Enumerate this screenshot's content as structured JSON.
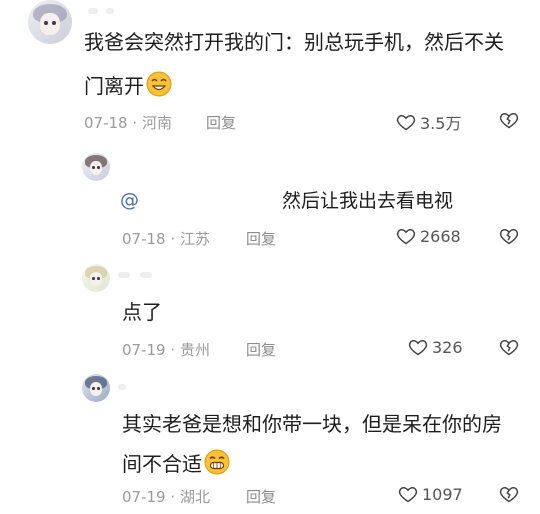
{
  "comments": [
    {
      "text_line1": "我爸会突然打开我的门：别总玩手机，然后不关",
      "text_line2": "门离开",
      "date": "07-18",
      "region": "河南",
      "reply_label": "回复",
      "likes": "3.5万",
      "emoji_icon": "squinting-smile-emoji"
    },
    {
      "mention": "@",
      "text_line1": "然后让我出去看电视",
      "date": "07-18",
      "region": "江苏",
      "reply_label": "回复",
      "likes": "2668"
    },
    {
      "text_line1": "点了",
      "date": "07-19",
      "region": "贵州",
      "reply_label": "回复",
      "likes": "326"
    },
    {
      "text_line1": "其实老爸是想和你带一块，但是呆在你的房",
      "text_line2": "间不合适",
      "date": "07-19",
      "region": "湖北",
      "reply_label": "回复",
      "likes": "1097",
      "emoji_icon": "grinning-teeth-emoji"
    }
  ],
  "meta_separator": "·",
  "icons": {
    "like": "heart-outline-icon",
    "dislike": "broken-heart-outline-icon"
  },
  "colors": {
    "text": "#1e1e1e",
    "meta": "#9a9a9a",
    "mention": "#4a6fa5",
    "emoji": "#f7c235"
  }
}
